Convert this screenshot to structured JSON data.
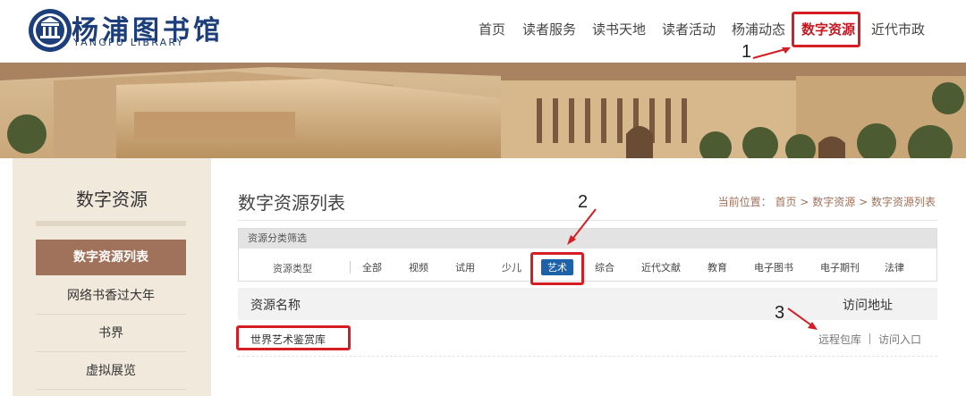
{
  "header": {
    "logo_title": "杨浦图书馆",
    "logo_subtitle": "YANGPU LIBRARY",
    "nav": [
      "首页",
      "读者服务",
      "读书天地",
      "读者活动",
      "杨浦动态",
      "数字资源",
      "近代市政"
    ],
    "active_nav": "数字资源"
  },
  "annotations": {
    "n1": "1",
    "n2": "2",
    "n3": "3"
  },
  "sidebar": {
    "title": "数字资源",
    "items": [
      "数字资源列表",
      "网络书香过大年",
      "书界",
      "虚拟展览"
    ]
  },
  "main": {
    "title": "数字资源列表",
    "breadcrumb": {
      "prefix": "当前位置：",
      "home": "首页",
      "sep": ">",
      "level1": "数字资源",
      "level2": "数字资源列表"
    },
    "filter": {
      "header": "资源分类筛选",
      "label": "资源类型",
      "categories": [
        "全部",
        "视频",
        "试用",
        "少儿",
        "艺术",
        "综合",
        "近代文献",
        "教育",
        "电子图书",
        "电子期刊",
        "法律"
      ],
      "selected": "艺术"
    },
    "table": {
      "col_name": "资源名称",
      "col_addr": "访问地址",
      "rows": [
        {
          "name": "世界艺术鉴赏库",
          "link1": "远程包库",
          "link2": "访问入口"
        }
      ]
    }
  },
  "colors": {
    "accent_red": "#d61d23",
    "brand_blue": "#1c3e7a",
    "sidebar_active": "#a0715b",
    "chip_active": "#1d62a8"
  }
}
